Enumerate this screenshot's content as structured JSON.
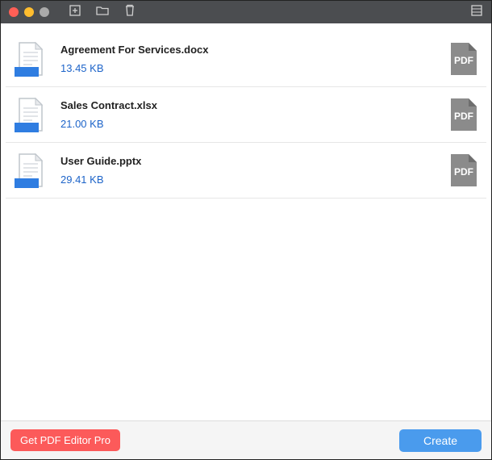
{
  "files": [
    {
      "name": "Agreement For Services.docx",
      "size": "13.45 KB"
    },
    {
      "name": "Sales Contract.xlsx",
      "size": "21.00 KB"
    },
    {
      "name": "User Guide.pptx",
      "size": "29.41 KB"
    }
  ],
  "pdf_label": "PDF",
  "footer": {
    "pro_button": "Get PDF Editor Pro",
    "create_button": "Create"
  }
}
